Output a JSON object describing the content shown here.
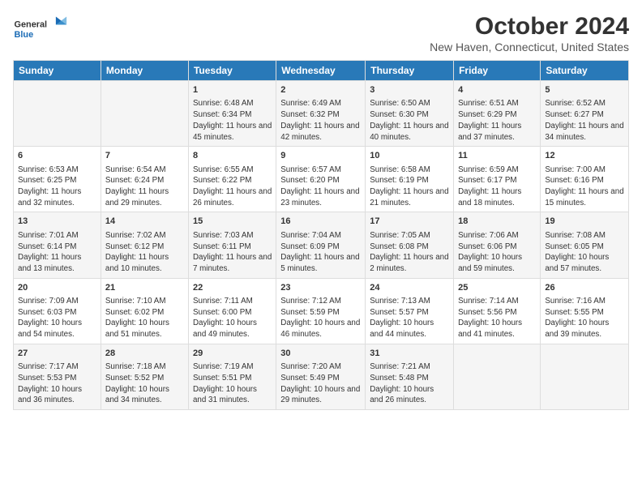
{
  "header": {
    "logo_general": "General",
    "logo_blue": "Blue",
    "month": "October 2024",
    "location": "New Haven, Connecticut, United States"
  },
  "days_of_week": [
    "Sunday",
    "Monday",
    "Tuesday",
    "Wednesday",
    "Thursday",
    "Friday",
    "Saturday"
  ],
  "weeks": [
    [
      {
        "day": "",
        "content": ""
      },
      {
        "day": "",
        "content": ""
      },
      {
        "day": "1",
        "content": "Sunrise: 6:48 AM\nSunset: 6:34 PM\nDaylight: 11 hours and 45 minutes."
      },
      {
        "day": "2",
        "content": "Sunrise: 6:49 AM\nSunset: 6:32 PM\nDaylight: 11 hours and 42 minutes."
      },
      {
        "day": "3",
        "content": "Sunrise: 6:50 AM\nSunset: 6:30 PM\nDaylight: 11 hours and 40 minutes."
      },
      {
        "day": "4",
        "content": "Sunrise: 6:51 AM\nSunset: 6:29 PM\nDaylight: 11 hours and 37 minutes."
      },
      {
        "day": "5",
        "content": "Sunrise: 6:52 AM\nSunset: 6:27 PM\nDaylight: 11 hours and 34 minutes."
      }
    ],
    [
      {
        "day": "6",
        "content": "Sunrise: 6:53 AM\nSunset: 6:25 PM\nDaylight: 11 hours and 32 minutes."
      },
      {
        "day": "7",
        "content": "Sunrise: 6:54 AM\nSunset: 6:24 PM\nDaylight: 11 hours and 29 minutes."
      },
      {
        "day": "8",
        "content": "Sunrise: 6:55 AM\nSunset: 6:22 PM\nDaylight: 11 hours and 26 minutes."
      },
      {
        "day": "9",
        "content": "Sunrise: 6:57 AM\nSunset: 6:20 PM\nDaylight: 11 hours and 23 minutes."
      },
      {
        "day": "10",
        "content": "Sunrise: 6:58 AM\nSunset: 6:19 PM\nDaylight: 11 hours and 21 minutes."
      },
      {
        "day": "11",
        "content": "Sunrise: 6:59 AM\nSunset: 6:17 PM\nDaylight: 11 hours and 18 minutes."
      },
      {
        "day": "12",
        "content": "Sunrise: 7:00 AM\nSunset: 6:16 PM\nDaylight: 11 hours and 15 minutes."
      }
    ],
    [
      {
        "day": "13",
        "content": "Sunrise: 7:01 AM\nSunset: 6:14 PM\nDaylight: 11 hours and 13 minutes."
      },
      {
        "day": "14",
        "content": "Sunrise: 7:02 AM\nSunset: 6:12 PM\nDaylight: 11 hours and 10 minutes."
      },
      {
        "day": "15",
        "content": "Sunrise: 7:03 AM\nSunset: 6:11 PM\nDaylight: 11 hours and 7 minutes."
      },
      {
        "day": "16",
        "content": "Sunrise: 7:04 AM\nSunset: 6:09 PM\nDaylight: 11 hours and 5 minutes."
      },
      {
        "day": "17",
        "content": "Sunrise: 7:05 AM\nSunset: 6:08 PM\nDaylight: 11 hours and 2 minutes."
      },
      {
        "day": "18",
        "content": "Sunrise: 7:06 AM\nSunset: 6:06 PM\nDaylight: 10 hours and 59 minutes."
      },
      {
        "day": "19",
        "content": "Sunrise: 7:08 AM\nSunset: 6:05 PM\nDaylight: 10 hours and 57 minutes."
      }
    ],
    [
      {
        "day": "20",
        "content": "Sunrise: 7:09 AM\nSunset: 6:03 PM\nDaylight: 10 hours and 54 minutes."
      },
      {
        "day": "21",
        "content": "Sunrise: 7:10 AM\nSunset: 6:02 PM\nDaylight: 10 hours and 51 minutes."
      },
      {
        "day": "22",
        "content": "Sunrise: 7:11 AM\nSunset: 6:00 PM\nDaylight: 10 hours and 49 minutes."
      },
      {
        "day": "23",
        "content": "Sunrise: 7:12 AM\nSunset: 5:59 PM\nDaylight: 10 hours and 46 minutes."
      },
      {
        "day": "24",
        "content": "Sunrise: 7:13 AM\nSunset: 5:57 PM\nDaylight: 10 hours and 44 minutes."
      },
      {
        "day": "25",
        "content": "Sunrise: 7:14 AM\nSunset: 5:56 PM\nDaylight: 10 hours and 41 minutes."
      },
      {
        "day": "26",
        "content": "Sunrise: 7:16 AM\nSunset: 5:55 PM\nDaylight: 10 hours and 39 minutes."
      }
    ],
    [
      {
        "day": "27",
        "content": "Sunrise: 7:17 AM\nSunset: 5:53 PM\nDaylight: 10 hours and 36 minutes."
      },
      {
        "day": "28",
        "content": "Sunrise: 7:18 AM\nSunset: 5:52 PM\nDaylight: 10 hours and 34 minutes."
      },
      {
        "day": "29",
        "content": "Sunrise: 7:19 AM\nSunset: 5:51 PM\nDaylight: 10 hours and 31 minutes."
      },
      {
        "day": "30",
        "content": "Sunrise: 7:20 AM\nSunset: 5:49 PM\nDaylight: 10 hours and 29 minutes."
      },
      {
        "day": "31",
        "content": "Sunrise: 7:21 AM\nSunset: 5:48 PM\nDaylight: 10 hours and 26 minutes."
      },
      {
        "day": "",
        "content": ""
      },
      {
        "day": "",
        "content": ""
      }
    ]
  ]
}
